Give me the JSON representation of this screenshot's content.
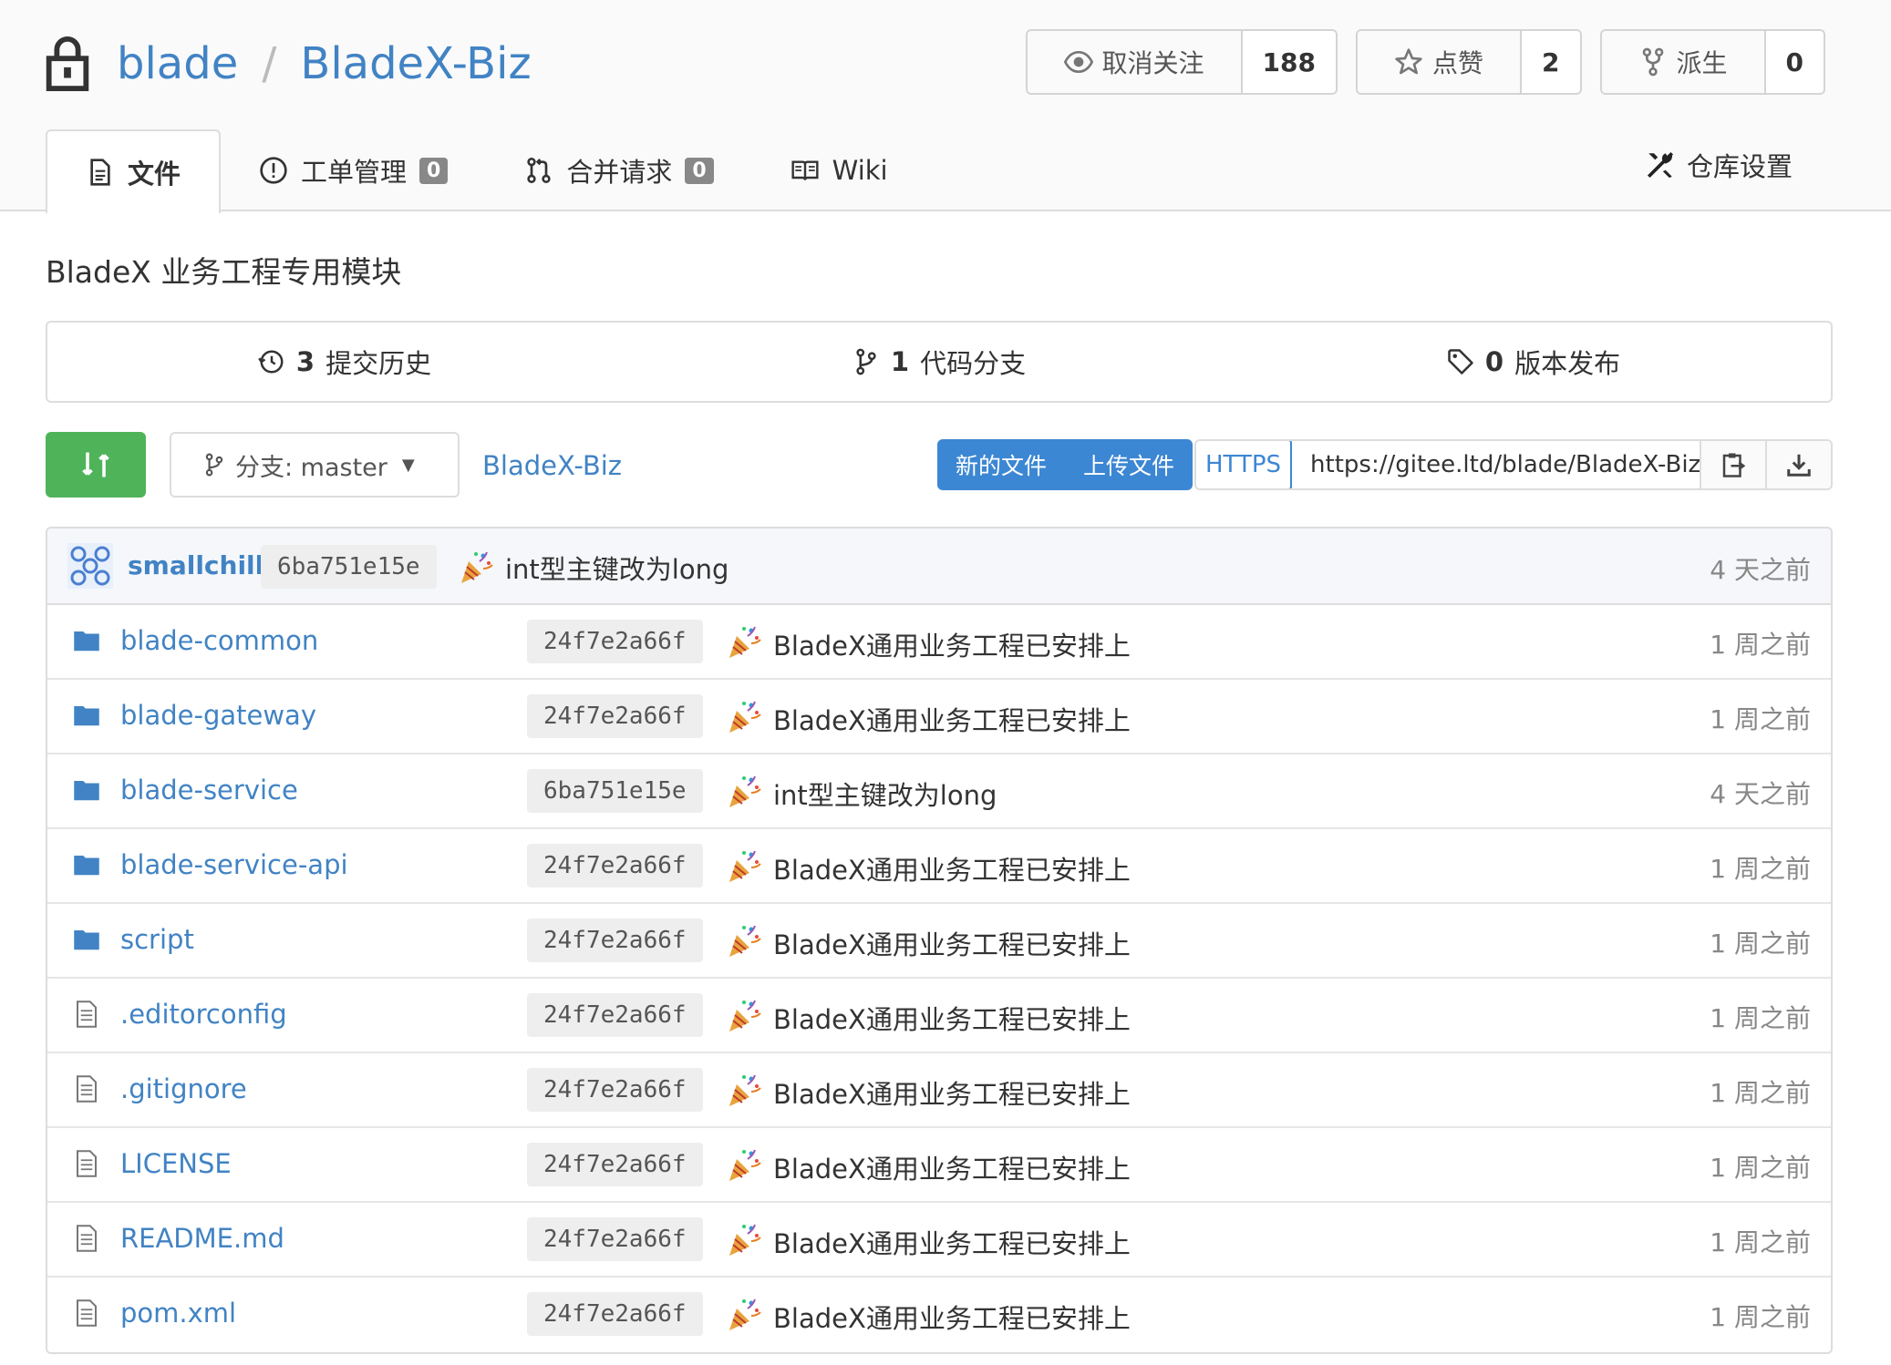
{
  "repo": {
    "owner": "blade",
    "separator": "/",
    "name": "BladeX-Biz",
    "description": "BladeX 业务工程专用模块"
  },
  "header_buttons": {
    "watch": {
      "label": "取消关注",
      "count": "188"
    },
    "star": {
      "label": "点赞",
      "count": "2"
    },
    "fork": {
      "label": "派生",
      "count": "0"
    }
  },
  "tabs": [
    {
      "label": "文件",
      "icon": "file-icon"
    },
    {
      "label": "工单管理",
      "badge": "0",
      "icon": "issue-icon"
    },
    {
      "label": "合并请求",
      "badge": "0",
      "icon": "pull-request-icon"
    },
    {
      "label": "Wiki",
      "icon": "book-icon"
    }
  ],
  "settings_tab": {
    "label": "仓库设置",
    "icon": "tools-icon"
  },
  "stats": [
    {
      "count": "3",
      "label": "提交历史",
      "icon": "history-icon"
    },
    {
      "count": "1",
      "label": "代码分支",
      "icon": "branch-icon"
    },
    {
      "count": "0",
      "label": "版本发布",
      "icon": "tag-icon"
    }
  ],
  "toolbar": {
    "branch_label": "分支: master",
    "repo_link": "BladeX-Biz",
    "new_file": "新的文件",
    "upload_file": "上传文件",
    "protocol": "HTTPS",
    "clone_url": "https://gitee.ltd/blade/BladeX-Biz.git"
  },
  "latest_commit": {
    "author": "smallchill",
    "sha": "6ba751e15e",
    "message": "int型主键改为long",
    "time": "4 天之前"
  },
  "files": [
    {
      "name": "blade-common",
      "type": "folder",
      "sha": "24f7e2a66f",
      "message": "BladeX通用业务工程已安排上",
      "time": "1 周之前"
    },
    {
      "name": "blade-gateway",
      "type": "folder",
      "sha": "24f7e2a66f",
      "message": "BladeX通用业务工程已安排上",
      "time": "1 周之前"
    },
    {
      "name": "blade-service",
      "type": "folder",
      "sha": "6ba751e15e",
      "message": "int型主键改为long",
      "time": "4 天之前"
    },
    {
      "name": "blade-service-api",
      "type": "folder",
      "sha": "24f7e2a66f",
      "message": "BladeX通用业务工程已安排上",
      "time": "1 周之前"
    },
    {
      "name": "script",
      "type": "folder",
      "sha": "24f7e2a66f",
      "message": "BladeX通用业务工程已安排上",
      "time": "1 周之前"
    },
    {
      "name": ".editorconfig",
      "type": "file",
      "sha": "24f7e2a66f",
      "message": "BladeX通用业务工程已安排上",
      "time": "1 周之前"
    },
    {
      "name": ".gitignore",
      "type": "file",
      "sha": "24f7e2a66f",
      "message": "BladeX通用业务工程已安排上",
      "time": "1 周之前"
    },
    {
      "name": "LICENSE",
      "type": "file",
      "sha": "24f7e2a66f",
      "message": "BladeX通用业务工程已安排上",
      "time": "1 周之前"
    },
    {
      "name": "README.md",
      "type": "file",
      "sha": "24f7e2a66f",
      "message": "BladeX通用业务工程已安排上",
      "time": "1 周之前"
    },
    {
      "name": "pom.xml",
      "type": "file",
      "sha": "24f7e2a66f",
      "message": "BladeX通用业务工程已安排上",
      "time": "1 周之前"
    }
  ],
  "colors": {
    "link": "#4183c4",
    "sync_button": "#4fb35a",
    "primary_button": "#3c87d3"
  }
}
